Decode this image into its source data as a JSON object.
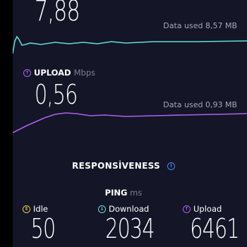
{
  "download": {
    "value": "7,88",
    "data_used": "Data used 8,57 MB",
    "color": "#5ce0d8"
  },
  "upload": {
    "label": "UPLOAD",
    "unit": "Mbps",
    "value": "0,56",
    "data_used": "Data used 0,93 MB",
    "color": "#a862f0",
    "icon": "arrow-up-circle-icon"
  },
  "responsiveness": {
    "title": "RESPONSİVENESS",
    "icon": "info-icon"
  },
  "ping": {
    "label": "PING",
    "unit": "ms",
    "idle": {
      "label": "Idle",
      "value": "50",
      "icon_color": "#e8c94a",
      "icon": "idle-icon"
    },
    "download": {
      "label": "Download",
      "value": "2034",
      "icon_color": "#5ce0d8",
      "icon": "arrow-down-circle-icon"
    },
    "upload": {
      "label": "Upload",
      "value": "6461",
      "icon_color": "#a862f0",
      "icon": "arrow-up-circle-icon"
    }
  }
}
